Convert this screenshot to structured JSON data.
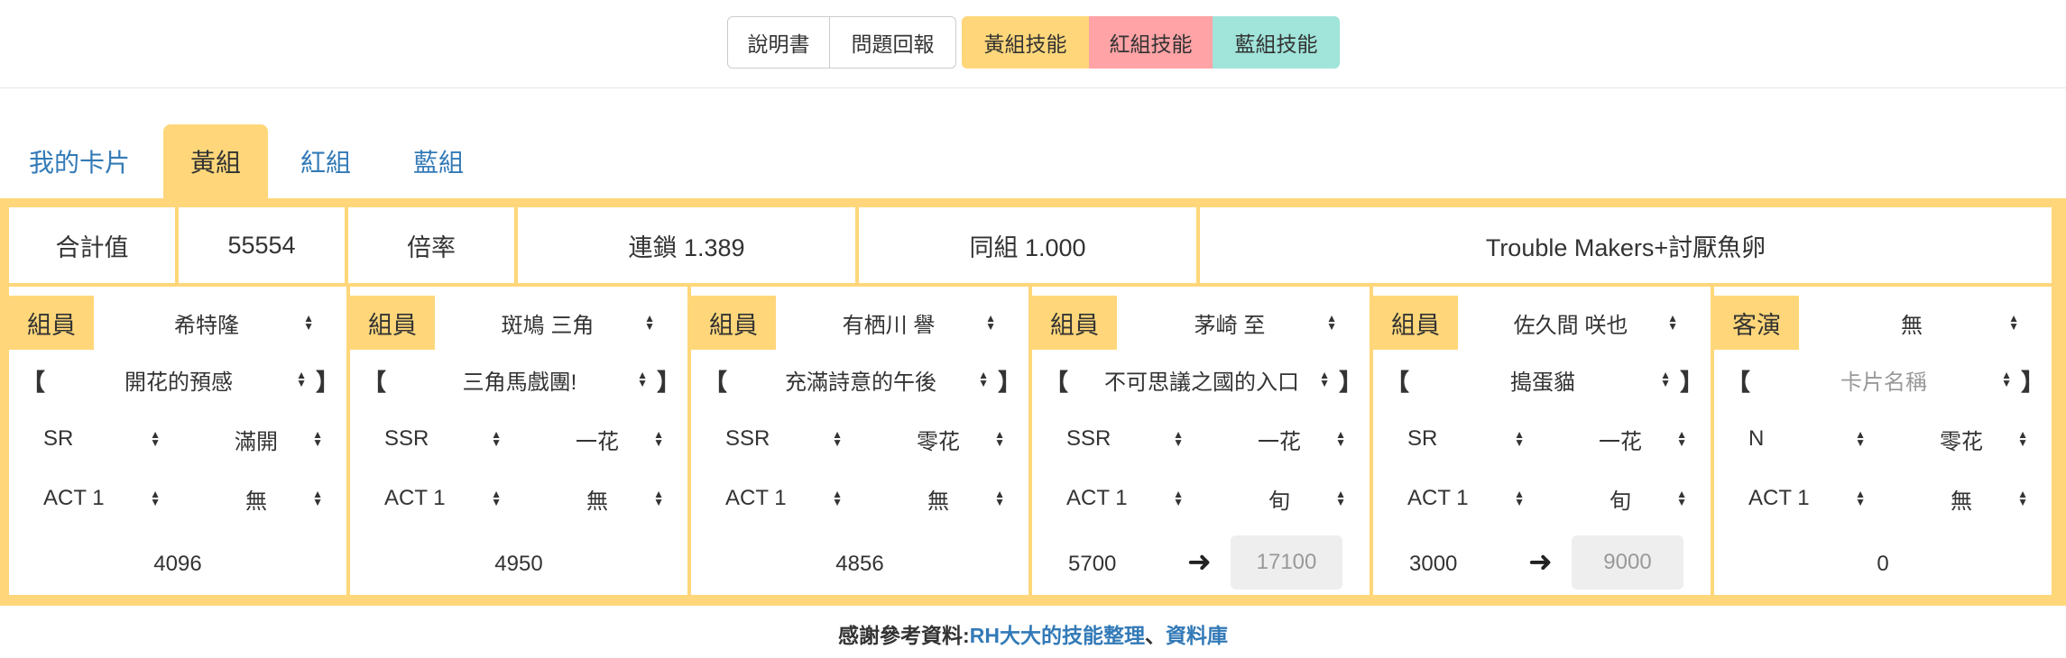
{
  "toolbar": {
    "manual": "說明書",
    "report": "問題回報",
    "yellow_skill": "黃組技能",
    "red_skill": "紅組技能",
    "blue_skill": "藍組技能",
    "colors": {
      "yellow": "#ffd77a",
      "red": "#ffa3a6",
      "blue": "#a0e4da"
    }
  },
  "tabs": [
    "我的卡片",
    "黃組",
    "紅組",
    "藍組"
  ],
  "active_tab": "黃組",
  "summary": {
    "total_label": "合計值",
    "total_value": "55554",
    "multiplier_label": "倍率",
    "chain": "連鎖 1.389",
    "same_group": "同組 1.000",
    "combo": "Trouble Makers+討厭魚卵"
  },
  "members": [
    {
      "role": "組員",
      "name": "希特隆",
      "card": "開花的預感",
      "rarity": "SR",
      "bloom": "滿開",
      "act": "ACT 1",
      "extra": "無",
      "score": "4096",
      "boosted": null
    },
    {
      "role": "組員",
      "name": "斑鳩 三角",
      "card": "三角馬戲團!",
      "rarity": "SSR",
      "bloom": "一花",
      "act": "ACT 1",
      "extra": "無",
      "score": "4950",
      "boosted": null
    },
    {
      "role": "組員",
      "name": "有栖川 譽",
      "card": "充滿詩意的午後",
      "rarity": "SSR",
      "bloom": "零花",
      "act": "ACT 1",
      "extra": "無",
      "score": "4856",
      "boosted": null
    },
    {
      "role": "組員",
      "name": "茅崎 至",
      "card": "不可思議之國的入口",
      "rarity": "SSR",
      "bloom": "一花",
      "act": "ACT 1",
      "extra": "旬",
      "score": "5700",
      "boosted": "17100"
    },
    {
      "role": "組員",
      "name": "佐久間 咲也",
      "card": "搗蛋貓",
      "rarity": "SR",
      "bloom": "一花",
      "act": "ACT 1",
      "extra": "旬",
      "score": "3000",
      "boosted": "9000"
    },
    {
      "role": "客演",
      "name": "無",
      "card": "卡片名稱",
      "card_placeholder": true,
      "rarity": "N",
      "bloom": "零花",
      "act": "ACT 1",
      "extra": "無",
      "score": "0",
      "boosted": null
    }
  ],
  "brackets": {
    "open": "【",
    "close": "】"
  },
  "footer": {
    "prefix": "感謝參考資料:",
    "link1": "RH大大的技能整理",
    "sep": "、",
    "link2": "資料庫"
  }
}
